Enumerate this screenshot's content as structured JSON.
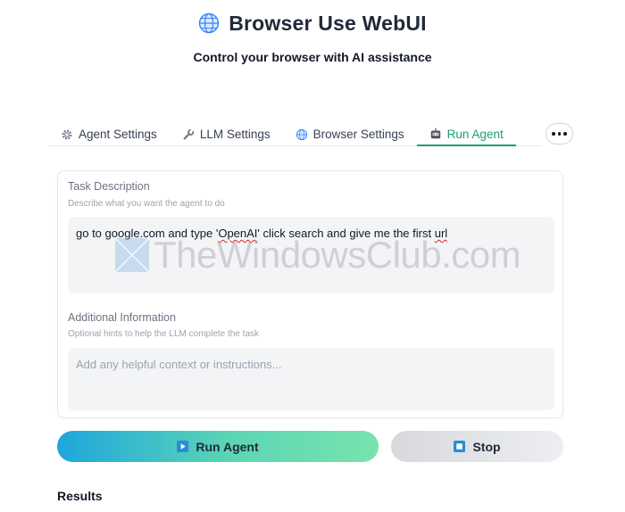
{
  "header": {
    "title": "Browser Use WebUI",
    "subtitle": "Control your browser with AI assistance",
    "icon": "globe-icon"
  },
  "tabs": [
    {
      "label": "Agent Settings",
      "icon": "gear-icon",
      "active": false
    },
    {
      "label": "LLM Settings",
      "icon": "wrench-icon",
      "active": false
    },
    {
      "label": "Browser Settings",
      "icon": "globe-icon",
      "active": false
    },
    {
      "label": "Run Agent",
      "icon": "robot-icon",
      "active": true
    }
  ],
  "task": {
    "label": "Task Description",
    "hint": "Describe what you want the agent to do",
    "value_parts": [
      "go to google.com and type '",
      "OpenAI",
      "' click search and give me the first ",
      "url"
    ]
  },
  "additional": {
    "label": "Additional Information",
    "hint": "Optional hints to help the LLM complete the task",
    "value": "",
    "placeholder": "Add any helpful context or instructions..."
  },
  "buttons": {
    "run_label": "Run Agent",
    "stop_label": "Stop"
  },
  "results": {
    "title": "Results"
  },
  "watermark": "TheWindowsClub.com",
  "colors": {
    "accent": "#1aa06d",
    "run_gradient_start": "#1ea6dc",
    "run_gradient_end": "#79e3ad",
    "stop_bg": "#e2e3e6"
  }
}
